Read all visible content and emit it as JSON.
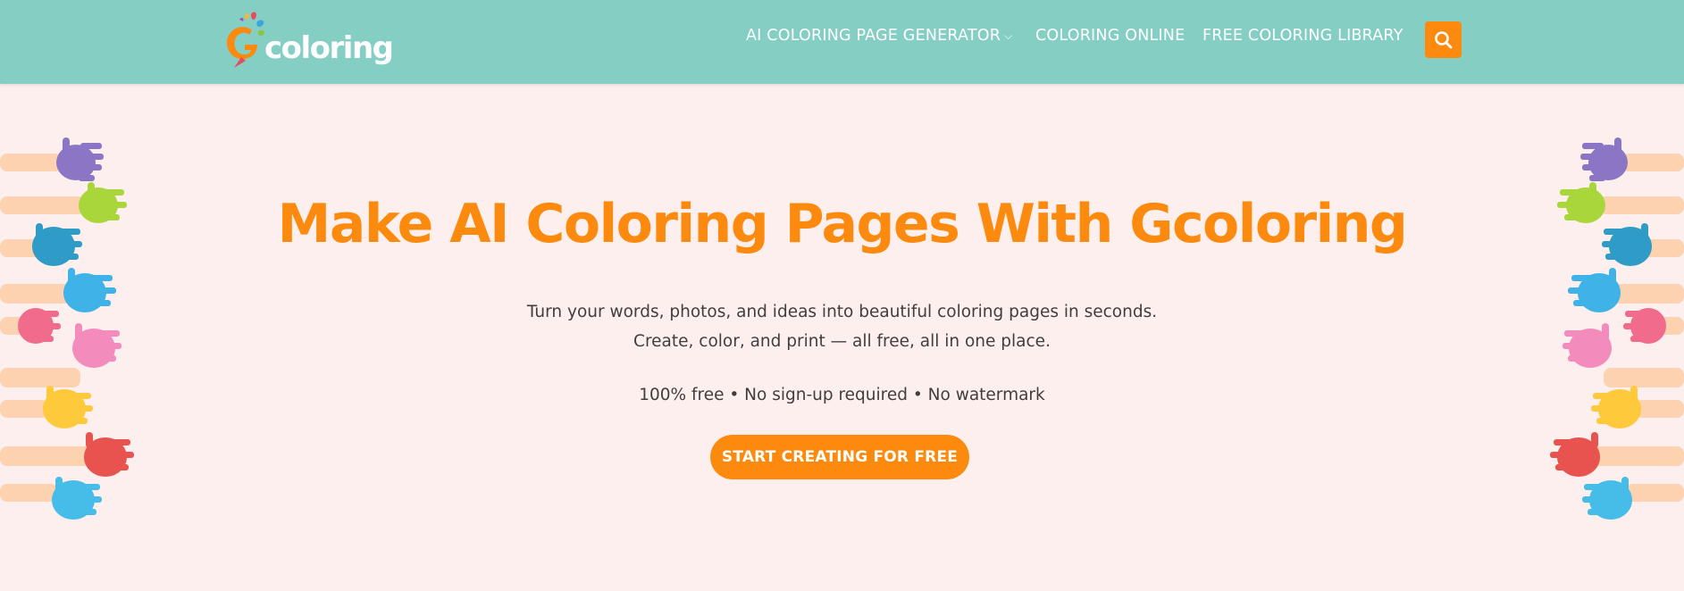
{
  "header": {
    "logo_text": "coloring",
    "nav": [
      {
        "label": "AI COLORING PAGE GENERATOR",
        "has_dropdown": true,
        "icon": "chevron-down-icon"
      },
      {
        "label": "COLORING ONLINE"
      },
      {
        "label": "FREE COLORING LIBRARY"
      }
    ],
    "search_icon": "search-icon"
  },
  "hero": {
    "title": "Make AI Coloring Pages With Gcoloring",
    "subtitle_line1": "Turn your words, photos, and ideas into beautiful coloring pages in seconds.",
    "subtitle_line2": "Create, color, and print — all free, all in one place.",
    "features": "100% free • No sign-up required • No watermark",
    "cta_label": "START CREATING FOR FREE"
  },
  "colors": {
    "header_bg": "#84cec4",
    "page_bg": "#fdefed",
    "accent": "#fb8a0e",
    "text": "#3f3f3f"
  }
}
